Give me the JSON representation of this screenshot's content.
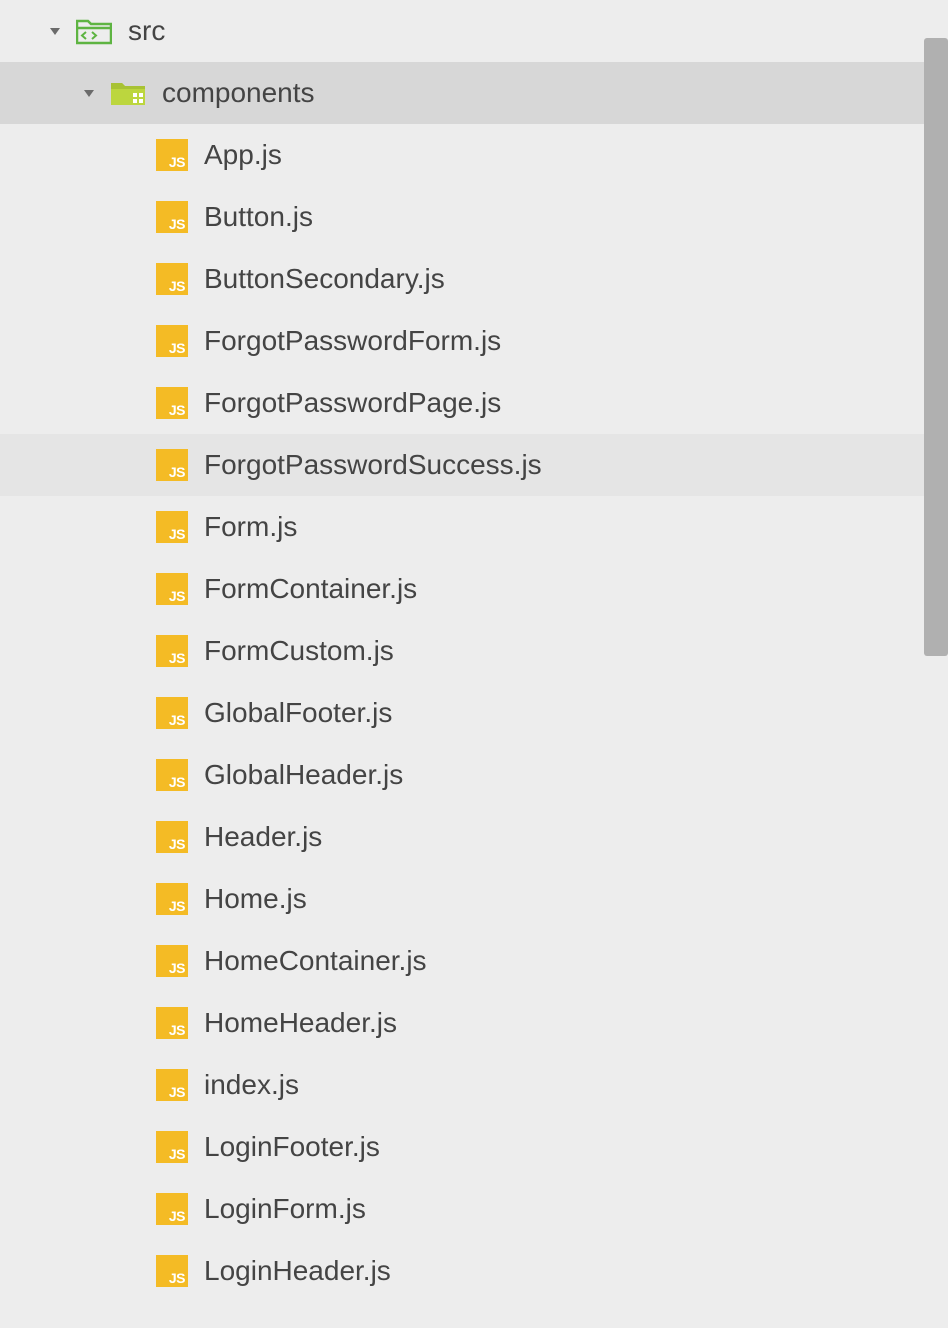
{
  "tree": {
    "root": {
      "name": "src",
      "expanded": true,
      "type": "folder-src"
    },
    "child": {
      "name": "components",
      "expanded": true,
      "type": "folder-components",
      "selected": true
    },
    "files": [
      {
        "name": "App.js"
      },
      {
        "name": "Button.js"
      },
      {
        "name": "ButtonSecondary.js"
      },
      {
        "name": "ForgotPasswordForm.js"
      },
      {
        "name": "ForgotPasswordPage.js"
      },
      {
        "name": "ForgotPasswordSuccess.js",
        "hovered": true
      },
      {
        "name": "Form.js"
      },
      {
        "name": "FormContainer.js"
      },
      {
        "name": "FormCustom.js"
      },
      {
        "name": "GlobalFooter.js"
      },
      {
        "name": "GlobalHeader.js"
      },
      {
        "name": "Header.js"
      },
      {
        "name": "Home.js"
      },
      {
        "name": "HomeContainer.js"
      },
      {
        "name": "HomeHeader.js"
      },
      {
        "name": "index.js"
      },
      {
        "name": "LoginFooter.js"
      },
      {
        "name": "LoginForm.js"
      },
      {
        "name": "LoginHeader.js"
      }
    ]
  },
  "icons": {
    "js_label": "JS"
  }
}
